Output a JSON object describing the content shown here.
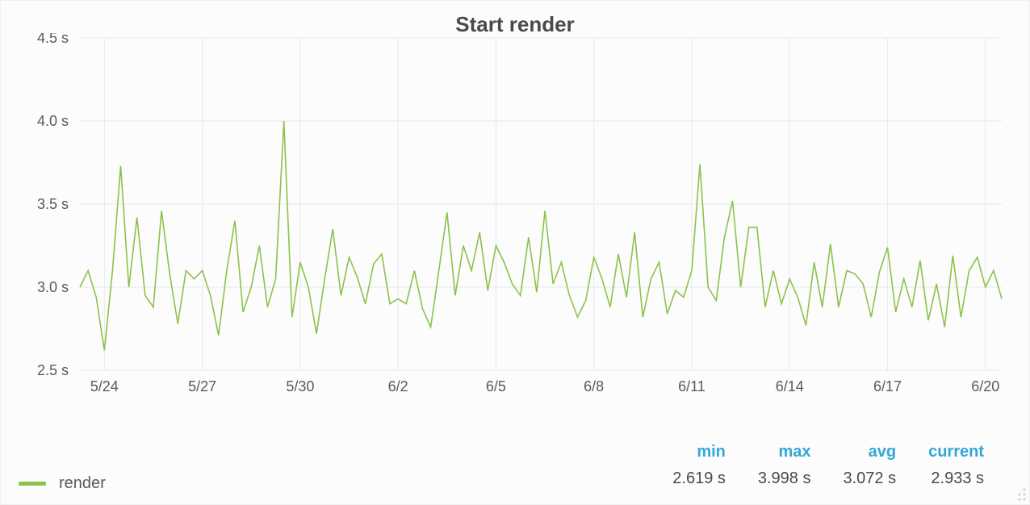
{
  "title": "Start render",
  "legend": {
    "series_name": "render"
  },
  "stats": {
    "headers": {
      "min": "min",
      "max": "max",
      "avg": "avg",
      "current": "current"
    },
    "values": {
      "min": "2.619 s",
      "max": "3.998 s",
      "avg": "3.072 s",
      "current": "2.933 s"
    }
  },
  "chart_data": {
    "type": "line",
    "title": "Start render",
    "xlabel": "",
    "ylabel": "",
    "ylim": [
      2.5,
      4.5
    ],
    "y_ticks": [
      2.5,
      3.0,
      3.5,
      4.0,
      4.5
    ],
    "y_tick_labels": [
      "2.5 s",
      "3.0 s",
      "3.5 s",
      "4.0 s",
      "4.5 s"
    ],
    "x_tick_positions": [
      3,
      15,
      27,
      39,
      51,
      63,
      75,
      87,
      99,
      111
    ],
    "x_tick_labels": [
      "5/24",
      "5/27",
      "5/30",
      "6/2",
      "6/5",
      "6/8",
      "6/11",
      "6/14",
      "6/17",
      "6/20"
    ],
    "series": [
      {
        "name": "render",
        "color": "#8bc34a",
        "x": [
          0,
          1,
          2,
          3,
          4,
          5,
          6,
          7,
          8,
          9,
          10,
          11,
          12,
          13,
          14,
          15,
          16,
          17,
          18,
          19,
          20,
          21,
          22,
          23,
          24,
          25,
          26,
          27,
          28,
          29,
          30,
          31,
          32,
          33,
          34,
          35,
          36,
          37,
          38,
          39,
          40,
          41,
          42,
          43,
          44,
          45,
          46,
          47,
          48,
          49,
          50,
          51,
          52,
          53,
          54,
          55,
          56,
          57,
          58,
          59,
          60,
          61,
          62,
          63,
          64,
          65,
          66,
          67,
          68,
          69,
          70,
          71,
          72,
          73,
          74,
          75,
          76,
          77,
          78,
          79,
          80,
          81,
          82,
          83,
          84,
          85,
          86,
          87,
          88,
          89,
          90,
          91,
          92,
          93,
          94,
          95,
          96,
          97,
          98,
          99,
          100,
          101,
          102,
          103,
          104,
          105,
          106,
          107,
          108,
          109,
          110,
          111,
          112,
          113
        ],
        "values": [
          3.0,
          3.1,
          2.94,
          2.62,
          3.1,
          3.73,
          3.0,
          3.42,
          2.95,
          2.88,
          3.46,
          3.08,
          2.78,
          3.1,
          3.05,
          3.1,
          2.95,
          2.71,
          3.1,
          3.4,
          2.85,
          3.0,
          3.25,
          2.88,
          3.05,
          4.0,
          2.82,
          3.15,
          3.0,
          2.72,
          3.05,
          3.35,
          2.95,
          3.18,
          3.06,
          2.9,
          3.14,
          3.2,
          2.9,
          2.93,
          2.9,
          3.1,
          2.87,
          2.76,
          3.1,
          3.45,
          2.95,
          3.25,
          3.1,
          3.33,
          2.98,
          3.25,
          3.15,
          3.02,
          2.95,
          3.3,
          2.97,
          3.46,
          3.02,
          3.15,
          2.95,
          2.82,
          2.92,
          3.18,
          3.05,
          2.88,
          3.2,
          2.94,
          3.33,
          2.82,
          3.05,
          3.15,
          2.84,
          2.98,
          2.94,
          3.1,
          3.74,
          3.0,
          2.92,
          3.3,
          3.52,
          3.0,
          3.36,
          3.36,
          2.88,
          3.1,
          2.9,
          3.05,
          2.94,
          2.77,
          3.15,
          2.88,
          3.26,
          2.88,
          3.1,
          3.08,
          3.02,
          2.82,
          3.09,
          3.24,
          2.85,
          3.05,
          2.88,
          3.16,
          2.8,
          3.02,
          2.76,
          3.19,
          2.82,
          3.1,
          3.18,
          3.0,
          3.1,
          2.93
        ]
      }
    ]
  }
}
